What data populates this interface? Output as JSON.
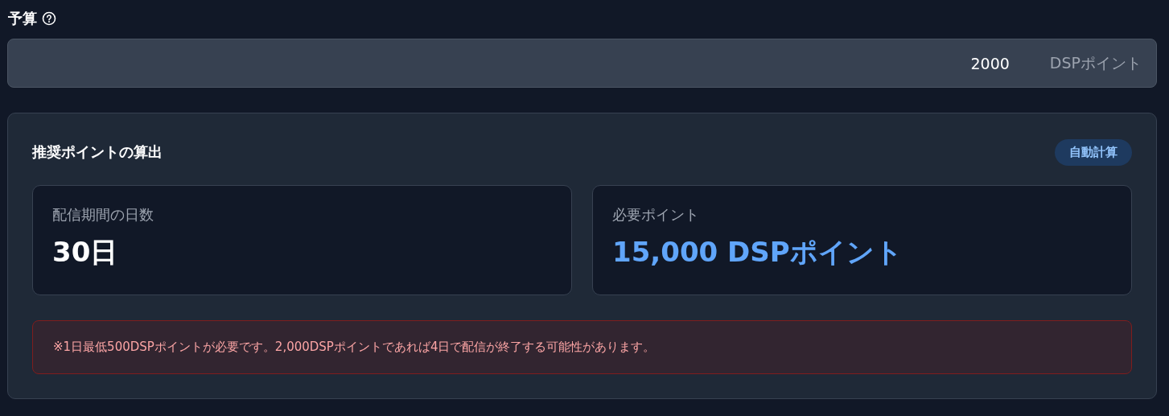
{
  "budget": {
    "label": "予算",
    "value": "2000",
    "unit": "DSPポイント"
  },
  "calculation": {
    "title": "推奨ポイントの算出",
    "badge": "自動計算",
    "stats": [
      {
        "label": "配信期間の日数",
        "value": "30日",
        "highlighted": false
      },
      {
        "label": "必要ポイント",
        "value": "15,000 DSPポイント",
        "highlighted": true
      }
    ],
    "warning": "※1日最低500DSPポイントが必要です。2,000DSPポイントであれば4日で配信が終了する可能性があります。"
  }
}
